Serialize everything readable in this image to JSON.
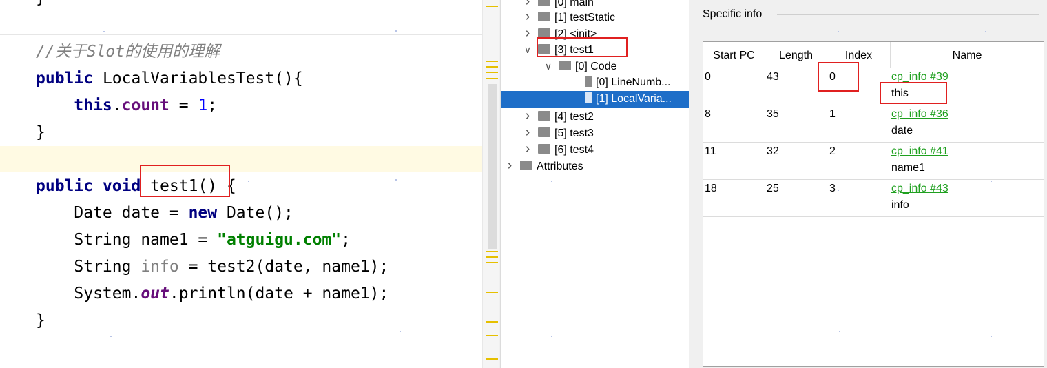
{
  "editor": {
    "lines": [
      {
        "tokens": [
          {
            "t": "}",
            "c": ""
          }
        ]
      },
      {
        "tokens": [
          {
            "t": "//关于Slot的使用的理解",
            "c": "cmt"
          }
        ]
      },
      {
        "tokens": [
          {
            "t": "public",
            "c": "kw"
          },
          {
            "t": " LocalVariablesTest(){",
            "c": ""
          }
        ]
      },
      {
        "tokens": [
          {
            "t": "    ",
            "c": ""
          },
          {
            "t": "this",
            "c": "kw"
          },
          {
            "t": ".",
            "c": ""
          },
          {
            "t": "count",
            "c": "fld"
          },
          {
            "t": " = ",
            "c": ""
          },
          {
            "t": "1",
            "c": "num"
          },
          {
            "t": ";",
            "c": ""
          }
        ]
      },
      {
        "tokens": [
          {
            "t": "}",
            "c": ""
          }
        ]
      },
      {
        "tokens": []
      },
      {
        "tokens": [
          {
            "t": "public",
            "c": "kw"
          },
          {
            "t": " ",
            "c": ""
          },
          {
            "t": "void",
            "c": "kw"
          },
          {
            "t": " test1() {",
            "c": ""
          }
        ]
      },
      {
        "tokens": [
          {
            "t": "    Date date = ",
            "c": ""
          },
          {
            "t": "new",
            "c": "kw"
          },
          {
            "t": " Date();",
            "c": ""
          }
        ]
      },
      {
        "tokens": [
          {
            "t": "    String name1 = ",
            "c": ""
          },
          {
            "t": "\"atguigu.com\"",
            "c": "str"
          },
          {
            "t": ";",
            "c": ""
          }
        ]
      },
      {
        "tokens": [
          {
            "t": "    String ",
            "c": ""
          },
          {
            "t": "info",
            "c": "unused"
          },
          {
            "t": " = test2(date, name1);",
            "c": ""
          }
        ]
      },
      {
        "tokens": [
          {
            "t": "    System.",
            "c": ""
          },
          {
            "t": "out",
            "c": "static"
          },
          {
            "t": ".println(date + name1);",
            "c": ""
          }
        ]
      },
      {
        "tokens": [
          {
            "t": "}",
            "c": ""
          }
        ]
      }
    ]
  },
  "tree": {
    "rows": [
      {
        "label": "[0] main",
        "level": 1,
        "chevron": ">",
        "kind": "folder"
      },
      {
        "label": "[1] testStatic",
        "level": 1,
        "chevron": ">",
        "kind": "folder"
      },
      {
        "label": "[2] <init>",
        "level": 1,
        "chevron": ">",
        "kind": "folder"
      },
      {
        "label": "[3] test1",
        "level": 1,
        "chevron": "v",
        "kind": "folder"
      },
      {
        "label": "[0] Code",
        "level": 2,
        "chevron": "v",
        "kind": "folder"
      },
      {
        "label": "[0] LineNumb...",
        "level": 3,
        "chevron": "",
        "kind": "doc"
      },
      {
        "label": "[1] LocalVaria...",
        "level": 3,
        "chevron": "",
        "kind": "doc",
        "selected": true
      },
      {
        "label": "[4] test2",
        "level": 1,
        "chevron": ">",
        "kind": "folder"
      },
      {
        "label": "[5] test3",
        "level": 1,
        "chevron": ">",
        "kind": "folder"
      },
      {
        "label": "[6] test4",
        "level": 1,
        "chevron": ">",
        "kind": "folder"
      },
      {
        "label": "Attributes",
        "level": 0,
        "chevron": ">",
        "kind": "folder"
      }
    ]
  },
  "info": {
    "title": "Specific info",
    "columns": [
      "Start PC",
      "Length",
      "Index",
      "Name"
    ],
    "rows": [
      {
        "start_pc": "0",
        "length": "43",
        "index": "0",
        "cp_link": "cp_info #39",
        "name": "this"
      },
      {
        "start_pc": "8",
        "length": "35",
        "index": "1",
        "cp_link": "cp_info #36",
        "name": "date"
      },
      {
        "start_pc": "11",
        "length": "32",
        "index": "2",
        "cp_link": "cp_info #41",
        "name": "name1"
      },
      {
        "start_pc": "18",
        "length": "25",
        "index": "3",
        "cp_link": "cp_info #43",
        "name": "info"
      }
    ]
  },
  "colors": {
    "keyword": "#000080",
    "string": "#008000",
    "link": "#1fa01f",
    "selection": "#1e6ec8",
    "annotation_box": "#e02020",
    "line_highlight": "#fffae3"
  }
}
